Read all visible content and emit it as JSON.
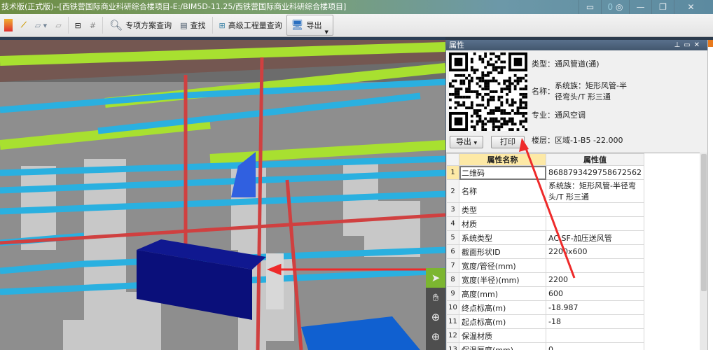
{
  "window": {
    "title": "技术版(正式版)--[西铁营国际商业科研综合楼项目-E:/BIM5D-11.25/西铁营国际商业科研综合楼项目]",
    "badge": "0"
  },
  "toolbar": {
    "special_query": "专项方案查询",
    "find": "查找",
    "advanced_query": "高级工程量查询",
    "export": "导出"
  },
  "nav_tools": [
    {
      "icon": "select-arrow-icon"
    },
    {
      "icon": "pan-hand-icon"
    },
    {
      "icon": "orbit-icon"
    },
    {
      "icon": "zoom-icon"
    }
  ],
  "panel": {
    "title": "属性",
    "info": {
      "type": "类型：通风管道(通)",
      "name_label": "名称：",
      "name_value": "系统族：矩形风管-半径弯头/T 形三通",
      "discipline": "专业：通风空调",
      "floor": "楼层：区域-1-B5 -22.000"
    },
    "export_button": "导出",
    "print_button": "打印",
    "table": {
      "headers": [
        "属性名称",
        "属性值"
      ],
      "rows": [
        [
          "1",
          "二维码",
          "8688793429758672562"
        ],
        [
          "2",
          "名称",
          "系统族：矩形风管-半径弯头/T 形三通"
        ],
        [
          "3",
          "类型",
          ""
        ],
        [
          "4",
          "材质",
          ""
        ],
        [
          "5",
          "系统类型",
          "AC SF-加压送风管"
        ],
        [
          "6",
          "截面形状ID",
          "2200x600"
        ],
        [
          "7",
          "宽度/管径(mm)",
          ""
        ],
        [
          "8",
          "宽度(半径)(mm)",
          "2200"
        ],
        [
          "9",
          "高度(mm)",
          "600"
        ],
        [
          "10",
          "终点标高(m)",
          "-18.987"
        ],
        [
          "11",
          "起点标高(m)",
          "-18"
        ],
        [
          "12",
          "保温材质",
          ""
        ],
        [
          "13",
          "保温厚度(mm)",
          "0"
        ]
      ]
    }
  }
}
